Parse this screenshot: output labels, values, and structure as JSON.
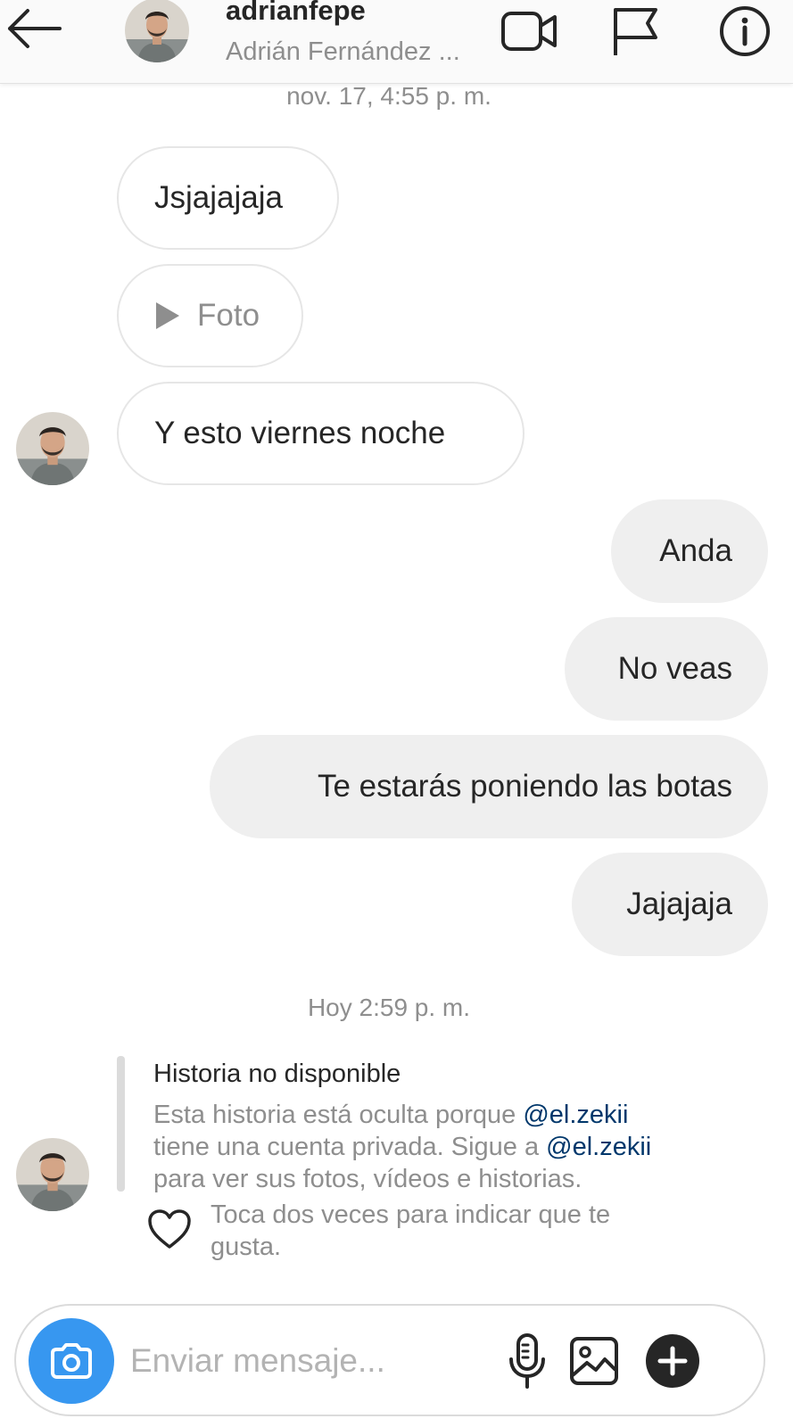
{
  "header": {
    "username": "adrianfepe",
    "full_name": "Adrián Fernández ...",
    "icons": [
      "back-arrow-icon",
      "video-camera-icon",
      "flag-icon",
      "info-icon"
    ]
  },
  "timestamps": [
    "nov. 17, 4:55 p. m.",
    "Hoy 2:59 p. m."
  ],
  "messages": {
    "received": [
      {
        "text": "Jsjajajaja"
      },
      {
        "text": "Foto",
        "icon": "play-icon"
      },
      {
        "text": "Y esto viernes noche"
      }
    ],
    "sent": [
      {
        "text": "Anda"
      },
      {
        "text": "No veas"
      },
      {
        "text": "Te estarás poniendo las botas"
      },
      {
        "text": "Jajajaja"
      }
    ]
  },
  "story_reply": {
    "title": "Historia no disponible",
    "line1_before": "Esta historia está oculta porque ",
    "mention": "@el.zekii",
    "line2_before": "tiene una cuenta privada. Sigue a ",
    "line3": "para ver sus fotos, vídeos e historias.",
    "like_hint": "Toca dos veces para indicar que te gusta."
  },
  "composer": {
    "placeholder": "Enviar mensaje...",
    "icons": [
      "camera-icon",
      "microphone-icon",
      "gallery-icon",
      "plus-icon"
    ]
  },
  "colors": {
    "accent": "#3797f0",
    "mention": "#00376b",
    "sent_bubble": "#efefef",
    "muted_text": "#8e8e8e"
  }
}
